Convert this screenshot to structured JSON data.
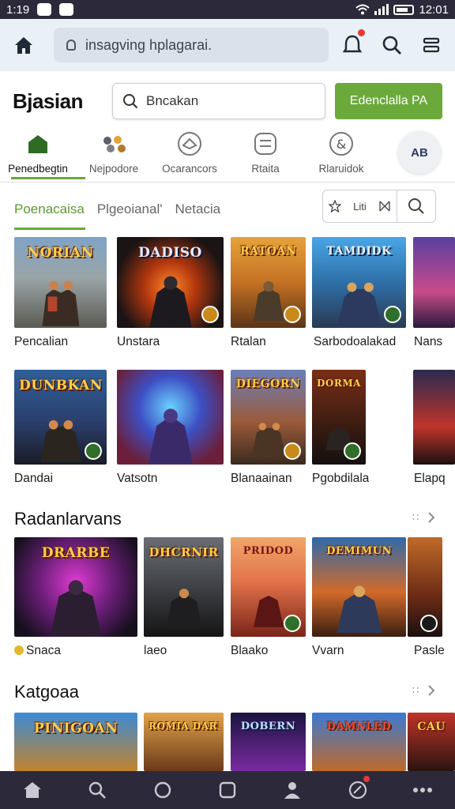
{
  "status_bar": {
    "time": "1:19",
    "right_time": "12:01"
  },
  "browser": {
    "url": "insagving hplagarai.",
    "icons": [
      "home-icon",
      "bell-icon",
      "search-icon",
      "tabs-icon"
    ]
  },
  "header": {
    "logo": "Bjasian",
    "search_placeholder": "Bncakan",
    "cta_label": "Edenclalla PA"
  },
  "categories": [
    {
      "label": "Penedbegtin",
      "icon": "home-icon"
    },
    {
      "label": "Nejpodore",
      "icon": "dots-icon"
    },
    {
      "label": "Ocarancors",
      "icon": "controller-icon"
    },
    {
      "label": "Rtaita",
      "icon": "list-icon"
    },
    {
      "label": "Rlaruidok",
      "icon": "ampersand-icon"
    }
  ],
  "avatar_label": "AB",
  "subtabs": [
    "Poenacaisa",
    "Plgeoianal'",
    "Netacia"
  ],
  "tab_tools": {
    "left_label": "Liti"
  },
  "grid_row1": [
    "Pencalian",
    "Unstara",
    "Rtalan",
    "Sarbodoalakad",
    "Nans"
  ],
  "grid_row2": [
    "Dandai",
    "Vatsotn",
    "Blanaainan",
    "Pgobdilala",
    "Elapq"
  ],
  "tile_titles_row1": [
    "NORIAN",
    "DADISO",
    "RATOAN",
    "TAMDIDK"
  ],
  "tile_titles_row2": [
    "DUNBKAN",
    "",
    "DIEGORN",
    "DORMAN"
  ],
  "sections": [
    {
      "title": "Radanlarvans",
      "items": [
        "Snaca",
        "laeo",
        "Blaako",
        "Vvarn",
        "Pasle"
      ],
      "tile_titles": [
        "DRARBE",
        "DHCRNIR",
        "PRIDOD",
        "DEMIMUN",
        ""
      ]
    },
    {
      "title": "Katgoaa",
      "tile_titles": [
        "PINIGOAN",
        "ROMIA DARL",
        "DOBERN",
        "DAMNLED",
        "CAU"
      ]
    }
  ],
  "colors": {
    "accent": "#6aa93a",
    "statusbar": "#2c2a3a",
    "browserbar": "#e9f0f6"
  },
  "bottom_nav": [
    "home-icon",
    "search-icon",
    "circle-icon",
    "square-icon",
    "person-icon",
    "rocket-icon",
    "more-icon"
  ]
}
